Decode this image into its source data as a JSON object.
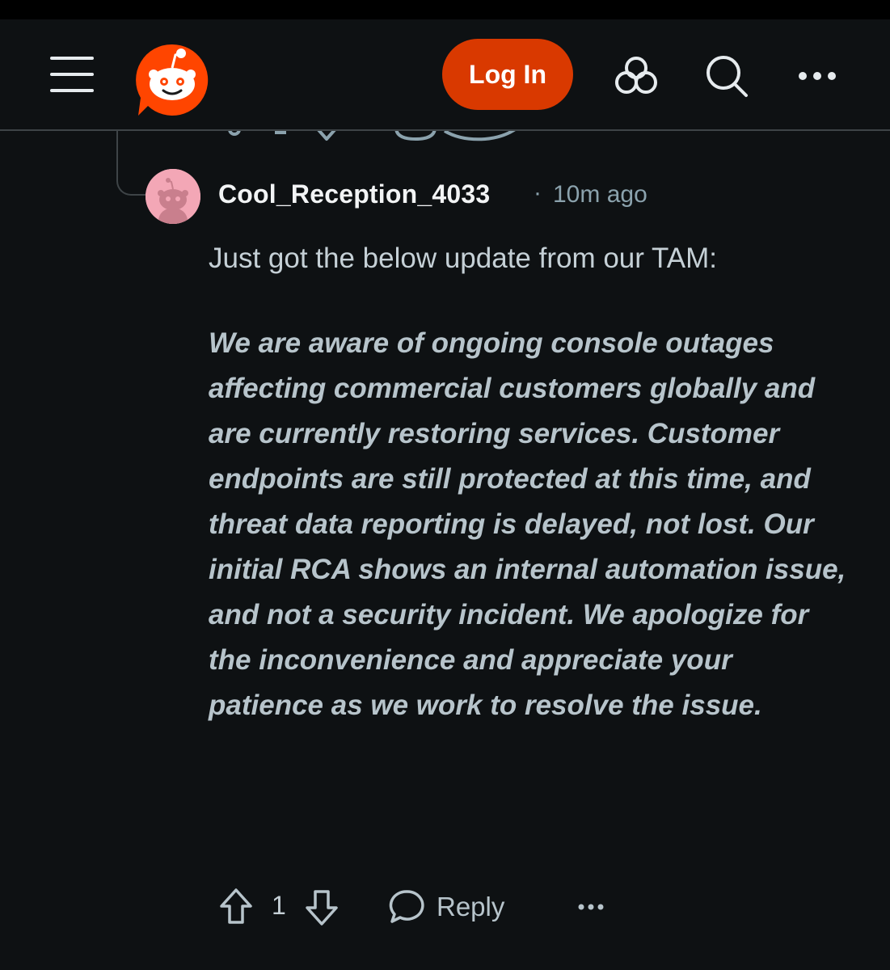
{
  "header": {
    "menu_icon": "hamburger-icon",
    "logo": "reddit-logo",
    "login_label": "Log In",
    "explore_icon": "explore-icon",
    "search_icon": "search-icon",
    "more_icon": "more-icon"
  },
  "comment": {
    "username": "Cool_Reception_4033",
    "separator": "·",
    "timestamp": "10m ago",
    "intro": "Just got the below update from our TAM:",
    "quote": "We are aware of ongoing console outages affecting commercial customers globally and are currently restoring services. Customer endpoints are still protected at this time, and threat data reporting is delayed, not lost. Our initial RCA shows an internal automation issue, and not a security incident. We apologize for the inconvenience and appreciate your patience as we work to resolve the issue.",
    "vote_count": "1",
    "reply_label": "Reply"
  },
  "colors": {
    "background": "#0e1113",
    "accent": "#d93900",
    "text_primary": "#f2f4f5",
    "text_secondary": "#8ba2ad"
  }
}
